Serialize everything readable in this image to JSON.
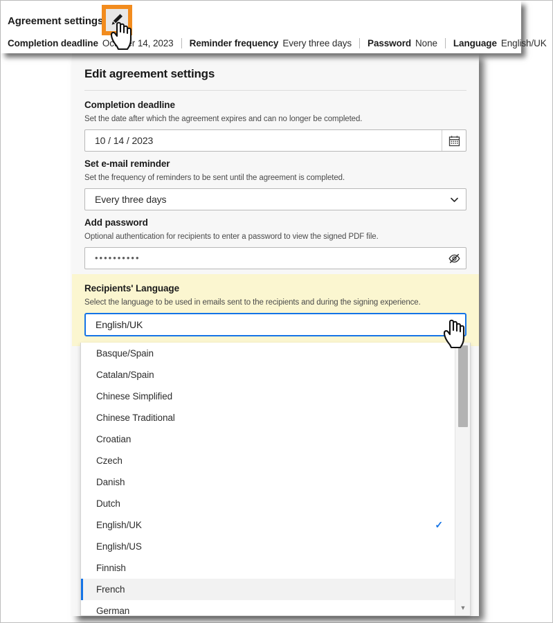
{
  "summary": {
    "title": "Agreement settings",
    "edit_icon": "pencil-icon",
    "meta": [
      {
        "label": "Completion deadline",
        "value": "October 14, 2023"
      },
      {
        "label": "Reminder frequency",
        "value": "Every three days"
      },
      {
        "label": "Password",
        "value": "None"
      },
      {
        "label": "Language",
        "value": "English/UK"
      }
    ]
  },
  "dialog": {
    "title": "Edit agreement settings",
    "fields": {
      "deadline": {
        "label": "Completion deadline",
        "description": "Set the date after which the agreement expires and can no longer be completed.",
        "value": "10 / 14 / 2023",
        "icon": "calendar-icon"
      },
      "reminder": {
        "label": "Set e-mail reminder",
        "description": "Set the frequency of reminders to be sent until the agreement is completed.",
        "value": "Every three days",
        "icon": "chevron-down-icon"
      },
      "password": {
        "label": "Add password",
        "description": "Optional authentication for recipients to enter a password to view the signed PDF file.",
        "value": "••••••••••",
        "icon": "eye-off-icon"
      },
      "language": {
        "label": "Recipients' Language",
        "description": "Select the language to be used in emails sent to the recipients and during the signing experience.",
        "value": "English/UK",
        "icon": "chevron-down-icon"
      }
    }
  },
  "language_dropdown": {
    "selected": "English/UK",
    "hovered": "French",
    "check_glyph": "✓",
    "scroll_down_glyph": "▼",
    "options": [
      "Basque/Spain",
      "Catalan/Spain",
      "Chinese Simplified",
      "Chinese Traditional",
      "Croatian",
      "Czech",
      "Danish",
      "Dutch",
      "English/UK",
      "English/US",
      "Finnish",
      "French",
      "German"
    ]
  },
  "colors": {
    "callout_orange": "#F28C1E",
    "focus_blue": "#1473E6",
    "highlight_yellow": "#FBF6D0",
    "dialog_bg": "#F7F7F7"
  }
}
